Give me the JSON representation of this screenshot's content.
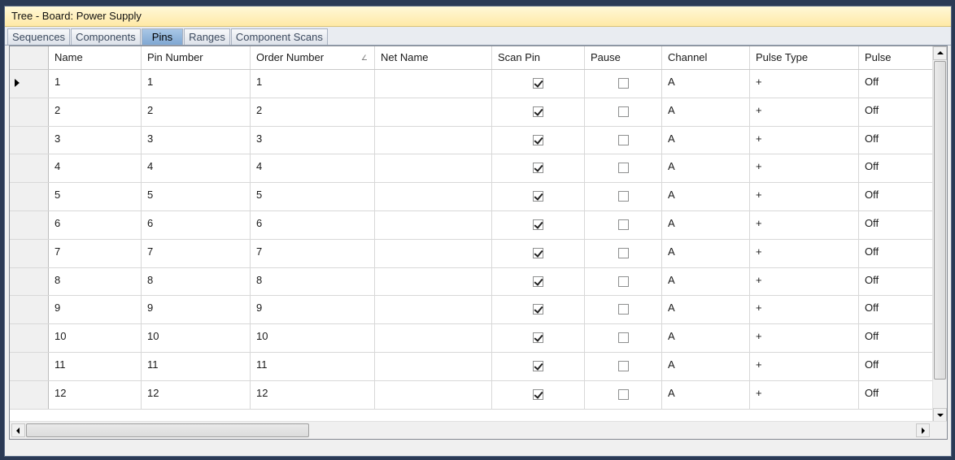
{
  "window": {
    "title": "Tree - Board: Power Supply"
  },
  "tabs": [
    {
      "label": "Sequences",
      "active": false
    },
    {
      "label": "Components",
      "active": false
    },
    {
      "label": "Pins",
      "active": true
    },
    {
      "label": "Ranges",
      "active": false
    },
    {
      "label": "Component Scans",
      "active": false
    }
  ],
  "grid": {
    "columns": [
      "Name",
      "Pin Number",
      "Order Number",
      "Net Name",
      "Scan Pin",
      "Pause",
      "Channel",
      "Pulse Type",
      "Pulse"
    ],
    "sort_glyph": "∠",
    "rows": [
      {
        "name": "1",
        "pin_number": "1",
        "order_number": "1",
        "net_name": "",
        "scan_pin": true,
        "pause": false,
        "channel": "A",
        "pulse_type": "+",
        "pulse": "Off"
      },
      {
        "name": "2",
        "pin_number": "2",
        "order_number": "2",
        "net_name": "",
        "scan_pin": true,
        "pause": false,
        "channel": "A",
        "pulse_type": "+",
        "pulse": "Off"
      },
      {
        "name": "3",
        "pin_number": "3",
        "order_number": "3",
        "net_name": "",
        "scan_pin": true,
        "pause": false,
        "channel": "A",
        "pulse_type": "+",
        "pulse": "Off"
      },
      {
        "name": "4",
        "pin_number": "4",
        "order_number": "4",
        "net_name": "",
        "scan_pin": true,
        "pause": false,
        "channel": "A",
        "pulse_type": "+",
        "pulse": "Off"
      },
      {
        "name": "5",
        "pin_number": "5",
        "order_number": "5",
        "net_name": "",
        "scan_pin": true,
        "pause": false,
        "channel": "A",
        "pulse_type": "+",
        "pulse": "Off"
      },
      {
        "name": "6",
        "pin_number": "6",
        "order_number": "6",
        "net_name": "",
        "scan_pin": true,
        "pause": false,
        "channel": "A",
        "pulse_type": "+",
        "pulse": "Off"
      },
      {
        "name": "7",
        "pin_number": "7",
        "order_number": "7",
        "net_name": "",
        "scan_pin": true,
        "pause": false,
        "channel": "A",
        "pulse_type": "+",
        "pulse": "Off"
      },
      {
        "name": "8",
        "pin_number": "8",
        "order_number": "8",
        "net_name": "",
        "scan_pin": true,
        "pause": false,
        "channel": "A",
        "pulse_type": "+",
        "pulse": "Off"
      },
      {
        "name": "9",
        "pin_number": "9",
        "order_number": "9",
        "net_name": "",
        "scan_pin": true,
        "pause": false,
        "channel": "A",
        "pulse_type": "+",
        "pulse": "Off"
      },
      {
        "name": "10",
        "pin_number": "10",
        "order_number": "10",
        "net_name": "",
        "scan_pin": true,
        "pause": false,
        "channel": "A",
        "pulse_type": "+",
        "pulse": "Off"
      },
      {
        "name": "11",
        "pin_number": "11",
        "order_number": "11",
        "net_name": "",
        "scan_pin": true,
        "pause": false,
        "channel": "A",
        "pulse_type": "+",
        "pulse": "Off"
      },
      {
        "name": "12",
        "pin_number": "12",
        "order_number": "12",
        "net_name": "",
        "scan_pin": true,
        "pause": false,
        "channel": "A",
        "pulse_type": "+",
        "pulse": "Off"
      }
    ]
  }
}
